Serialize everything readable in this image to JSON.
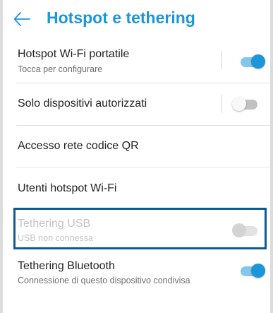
{
  "header": {
    "title": "Hotspot e tethering",
    "back_icon": "arrow-left-icon"
  },
  "items": [
    {
      "label": "Hotspot Wi-Fi portatile",
      "sublabel": "Tocca per configurare",
      "toggle": "on"
    },
    {
      "label": "Solo dispositivi autorizzati",
      "toggle": "off"
    },
    {
      "label": "Accesso rete codice QR"
    },
    {
      "label": "Utenti hotspot Wi-Fi"
    },
    {
      "label": "Tethering USB",
      "sublabel": "USB non connessa",
      "toggle": "off",
      "enabled": false
    },
    {
      "label": "Tethering Bluetooth",
      "sublabel": "Connessione di questo dispositivo condivisa",
      "toggle": "on"
    }
  ],
  "colors": {
    "accent": "#1b96d8",
    "highlight_border": "#0f5a96"
  }
}
